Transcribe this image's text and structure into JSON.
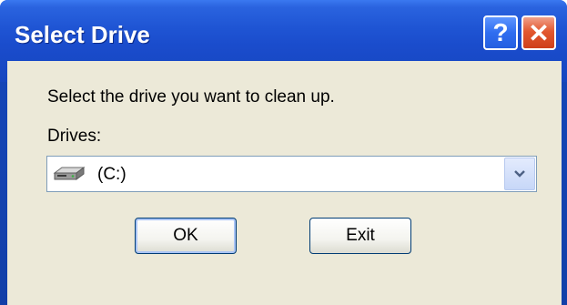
{
  "window": {
    "title": "Select Drive",
    "help_glyph": "?",
    "close_glyph": "✕"
  },
  "dialog": {
    "instruction": "Select the drive you want to clean up.",
    "drives_label": "Drives:",
    "selected_drive": "(C:)",
    "drive_icon": "hard-drive-icon"
  },
  "buttons": {
    "ok": "OK",
    "exit": "Exit"
  },
  "colors": {
    "titlebar": "#1f55d4",
    "client_bg": "#ece9d8",
    "close_button": "#e2582f"
  }
}
